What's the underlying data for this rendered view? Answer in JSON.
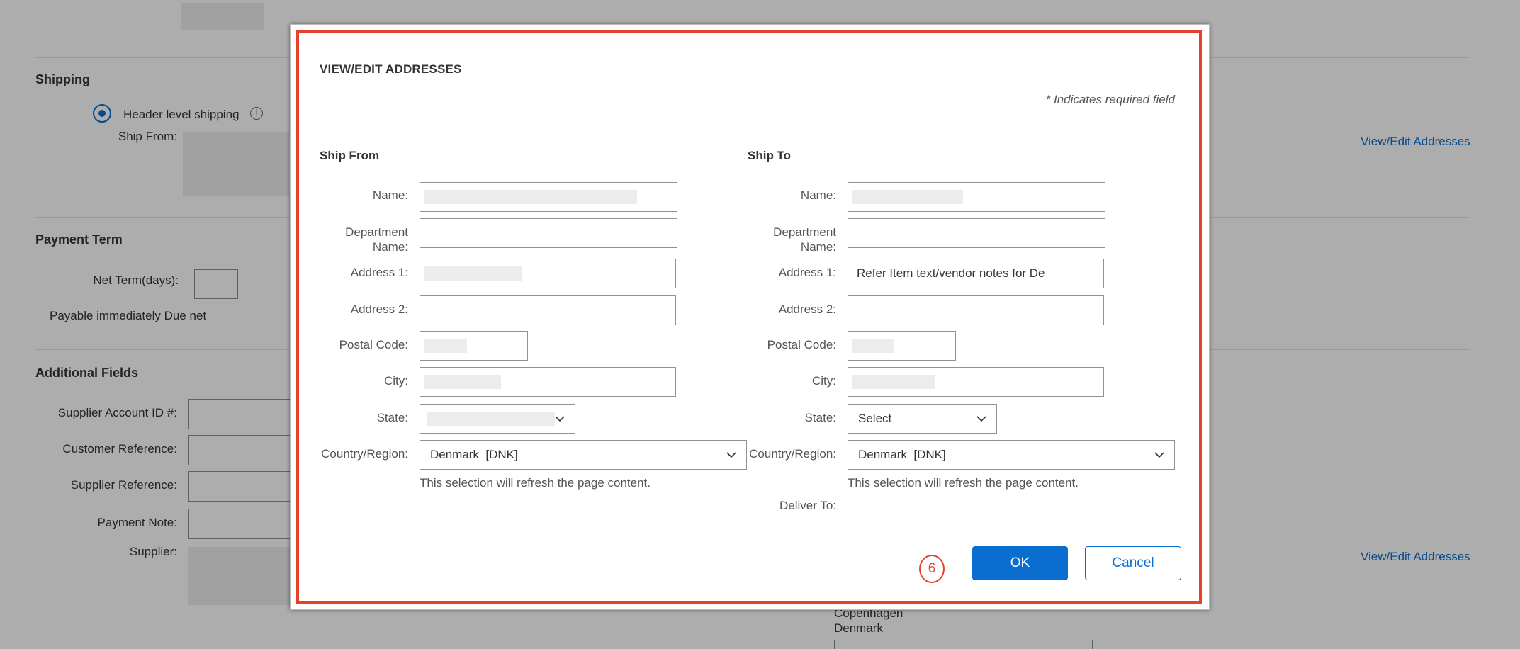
{
  "background": {
    "shipping": {
      "title": "Shipping",
      "header_level_label": "Header level shipping",
      "ship_from_label": "Ship From:",
      "link": "View/Edit Addresses"
    },
    "payment_term": {
      "title": "Payment Term",
      "net_term_label": "Net Term(days):",
      "payable_text": "Payable immediately Due net"
    },
    "additional_fields": {
      "title": "Additional Fields",
      "labels": [
        "Supplier Account ID #:",
        "Customer Reference:",
        "Supplier Reference:",
        "Payment Note:",
        "Supplier:"
      ],
      "link": "View/Edit Addresses",
      "city_text": "Copenhagen",
      "country_text": "Denmark"
    }
  },
  "dialog": {
    "title": "VIEW/EDIT ADDRESSES",
    "required_note": "* Indicates required field",
    "ship_from": {
      "title": "Ship From",
      "labels": {
        "name": "Name:",
        "department": "Department Name:",
        "address1": "Address 1:",
        "address2": "Address 2:",
        "postal": "Postal Code:",
        "city": "City:",
        "state": "State:",
        "country": "Country/Region:"
      },
      "country_value": "Denmark  [DNK]",
      "hint": "This selection will refresh the page content."
    },
    "ship_to": {
      "title": "Ship To",
      "labels": {
        "name": "Name:",
        "department": "Department Name:",
        "address1": "Address 1:",
        "address2": "Address 2:",
        "postal": "Postal Code:",
        "city": "City:",
        "state": "State:",
        "country": "Country/Region:",
        "deliver_to": "Deliver To:"
      },
      "address1_value": "Refer Item text/vendor notes for De",
      "state_value": "Select",
      "country_value": "Denmark  [DNK]",
      "hint": "This selection will refresh the page content."
    },
    "buttons": {
      "ok": "OK",
      "cancel": "Cancel"
    },
    "step_badge": "6"
  },
  "icons": [
    "info-icon",
    "chevron-down-icon"
  ],
  "colors": {
    "accent": "#0a6ed1",
    "highlight": "#e8412a"
  }
}
